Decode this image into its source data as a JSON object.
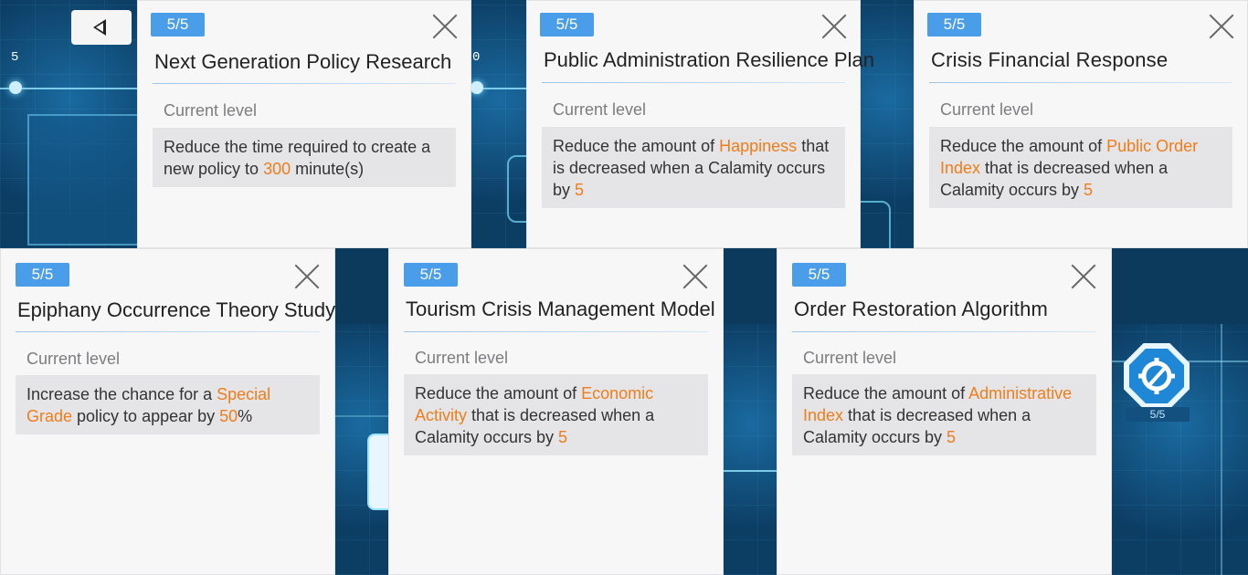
{
  "background": {
    "back_label": "",
    "marker_left": "5",
    "marker_mid": "0",
    "gear_level": "5/5"
  },
  "colors": {
    "badge": "#4a9de8",
    "highlight": "#ef7d1a"
  },
  "cards": [
    {
      "badge": "5/5",
      "title": "Next Generation Policy Research",
      "level_label": "Current level",
      "desc": [
        {
          "t": "Reduce the time required to create a new policy to "
        },
        {
          "t": "300",
          "hl": true
        },
        {
          "t": " minute(s)"
        }
      ]
    },
    {
      "badge": "5/5",
      "title": "Public Administration Resilience Plan",
      "level_label": "Current level",
      "desc": [
        {
          "t": "Reduce the amount of "
        },
        {
          "t": "Happiness",
          "hl": true
        },
        {
          "t": " that is decreased when a Calamity occurs by "
        },
        {
          "t": "5",
          "hl": true
        }
      ]
    },
    {
      "badge": "5/5",
      "title": "Crisis Financial Response",
      "level_label": "Current level",
      "desc": [
        {
          "t": "Reduce the amount of "
        },
        {
          "t": "Public Order Index",
          "hl": true
        },
        {
          "t": " that is decreased when a Calamity occurs by "
        },
        {
          "t": "5",
          "hl": true
        }
      ]
    },
    {
      "badge": "5/5",
      "title": "Epiphany Occurrence Theory Study",
      "level_label": "Current level",
      "desc": [
        {
          "t": "Increase the chance for a "
        },
        {
          "t": "Special Grade",
          "hl": true
        },
        {
          "t": " policy to appear by "
        },
        {
          "t": "50",
          "hl": true
        },
        {
          "t": "%"
        }
      ]
    },
    {
      "badge": "5/5",
      "title": "Tourism Crisis Management Model",
      "level_label": "Current level",
      "desc": [
        {
          "t": "Reduce the amount of "
        },
        {
          "t": "Economic Activity",
          "hl": true
        },
        {
          "t": " that is decreased when a Calamity occurs by "
        },
        {
          "t": "5",
          "hl": true
        }
      ]
    },
    {
      "badge": "5/5",
      "title": "Order Restoration Algorithm",
      "level_label": "Current level",
      "desc": [
        {
          "t": "Reduce the amount of "
        },
        {
          "t": "Administrative Index",
          "hl": true
        },
        {
          "t": " that is decreased when a Calamity occurs by "
        },
        {
          "t": "5",
          "hl": true
        }
      ]
    }
  ]
}
